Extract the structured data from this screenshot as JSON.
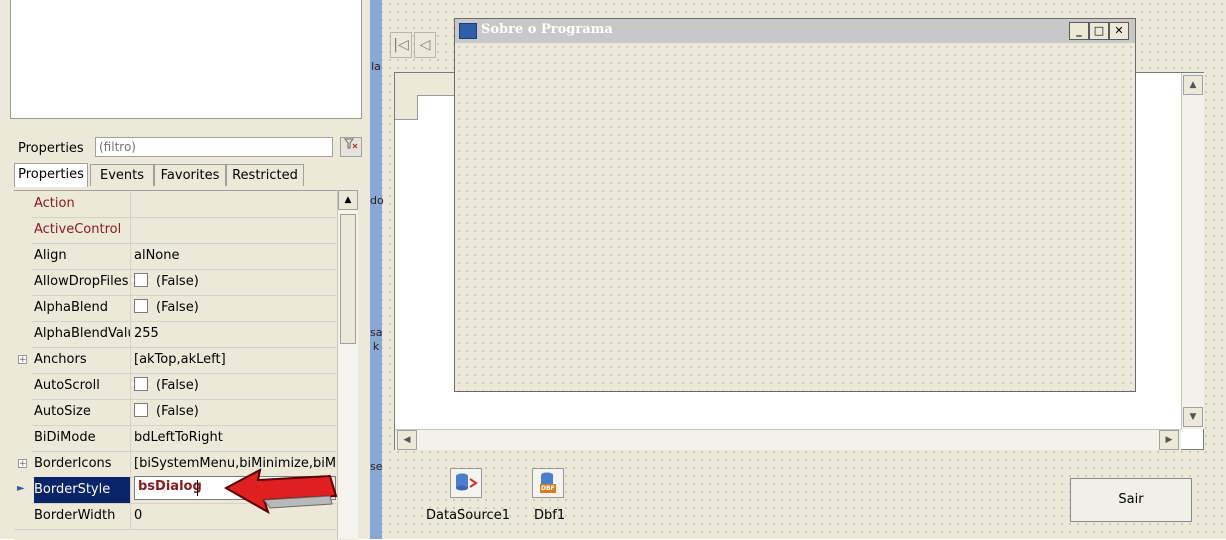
{
  "inspector": {
    "filter_label": "Properties",
    "filter_placeholder": "(filtro)",
    "tabs": [
      "Properties",
      "Events",
      "Favorites",
      "Restricted"
    ],
    "rows": [
      {
        "name": "Action",
        "value": ""
      },
      {
        "name": "ActiveControl",
        "value": ""
      },
      {
        "name": "Align",
        "value": "alNone"
      },
      {
        "name": "AllowDropFiles",
        "value": "(False)"
      },
      {
        "name": "AlphaBlend",
        "value": "(False)"
      },
      {
        "name": "AlphaBlendValu",
        "value": "255"
      },
      {
        "name": "Anchors",
        "value": "[akTop,akLeft]"
      },
      {
        "name": "AutoScroll",
        "value": "(False)"
      },
      {
        "name": "AutoSize",
        "value": "(False)"
      },
      {
        "name": "BiDiMode",
        "value": "bdLeftToRight"
      },
      {
        "name": "BorderIcons",
        "value": "[biSystemMenu,biMinimize,biMax"
      },
      {
        "name": "BorderStyle",
        "value": "bsDialog"
      },
      {
        "name": "BorderWidth",
        "value": "0"
      }
    ]
  },
  "designer": {
    "dialog_title": "Sobre o Programa",
    "components": [
      {
        "label": "DataSource1"
      },
      {
        "label": "Dbf1",
        "badge": "DBF"
      }
    ],
    "sair_label": "Sair",
    "strip_glyphs": [
      "la",
      "do",
      "sa",
      "k",
      "se"
    ]
  }
}
